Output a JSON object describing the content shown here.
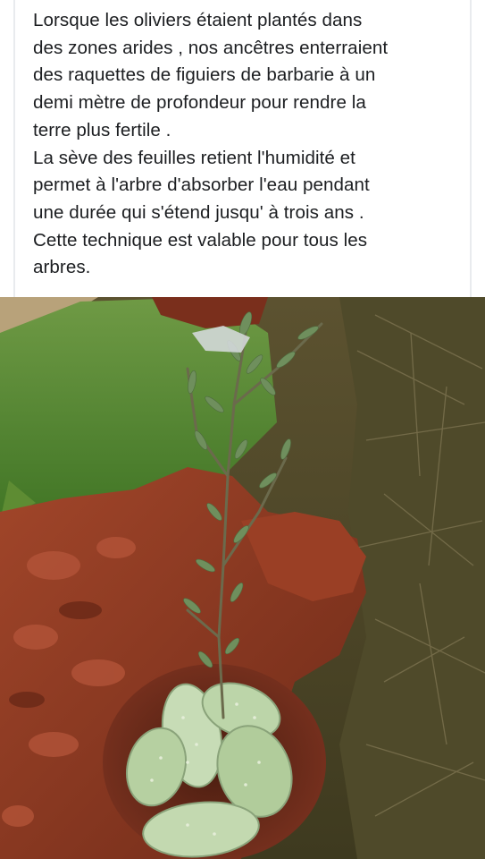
{
  "post": {
    "caption_lines": [
      "Lorsque les oliviers étaient plantés dans",
      "des zones arides , nos ancêtres enterraient",
      "des raquettes de figuiers de barbarie à un",
      "demi mètre de profondeur pour rendre la",
      "terre plus fertile .",
      "La sève des feuilles retient l'humidité et",
      "permet à l'arbre d'absorber l'eau pendant",
      "une durée qui s'étend jusqu' à trois ans .",
      "Cette technique est valable pour tous les",
      "arbres."
    ]
  },
  "photo": {
    "subject": "olive-sapling-with-cactus-pads"
  },
  "colors": {
    "text": "#1c1e21",
    "background": "#ffffff",
    "soil": "#8e3a22",
    "grass": "#4f8a2e",
    "cactus": "#b9d3a8"
  }
}
